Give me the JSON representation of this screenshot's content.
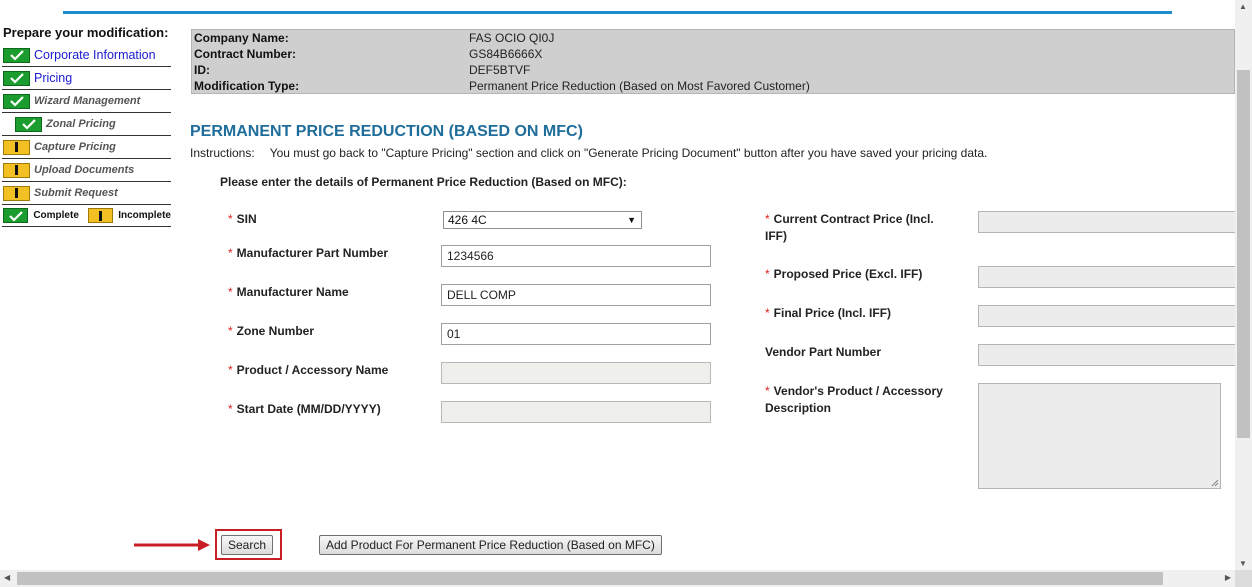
{
  "sidebar": {
    "title": "Prepare your modification:",
    "items": [
      {
        "label": "Corporate Information",
        "status": "complete",
        "style": "link"
      },
      {
        "label": "Pricing",
        "status": "complete",
        "style": "link"
      },
      {
        "label": "Wizard Management",
        "status": "complete",
        "style": "muted"
      },
      {
        "label": "Zonal Pricing",
        "status": "complete",
        "style": "muted"
      },
      {
        "label": "Capture Pricing",
        "status": "incomplete",
        "style": "muted"
      },
      {
        "label": "Upload Documents",
        "status": "incomplete",
        "style": "muted"
      },
      {
        "label": "Submit Request",
        "status": "incomplete",
        "style": "muted"
      }
    ],
    "legend": {
      "complete": "Complete",
      "incomplete": "Incomplete"
    }
  },
  "info": {
    "company_label": "Company Name:",
    "company_value": "FAS OCIO QI0J",
    "contract_label": "Contract Number:",
    "contract_value": "GS84B6666X",
    "id_label": "ID:",
    "id_value": "DEF5BTVF",
    "modtype_label": "Modification Type:",
    "modtype_value": "Permanent Price Reduction (Based on Most Favored Customer)"
  },
  "page": {
    "heading": "PERMANENT PRICE REDUCTION (BASED ON MFC)",
    "instructions_label": "Instructions:",
    "instructions_text": "You must go back to \"Capture Pricing\" section and click on \"Generate Pricing Document\" button after you have saved your pricing data.",
    "subheading": "Please enter the details of Permanent Price Reduction (Based on MFC):"
  },
  "form": {
    "required_marker": "*",
    "sin_label": "SIN",
    "sin_value": "426 4C",
    "mpn_label": "Manufacturer Part Number",
    "mpn_value": "1234566",
    "mname_label": "Manufacturer Name",
    "mname_value": "DELL COMP",
    "zone_label": "Zone Number",
    "zone_value": "01",
    "product_label": "Product / Accessory Name",
    "product_value": "",
    "start_label": "Start Date (MM/DD/YYYY)",
    "start_value": "",
    "ccp_label_1": "Current Contract Price (Incl.",
    "ccp_label_2": "IFF)",
    "proposed_label": "Proposed Price (Excl. IFF)",
    "final_label": "Final Price (Incl. IFF)",
    "vpn_label": "Vendor Part Number",
    "desc_label_1": "Vendor's Product / Accessory",
    "desc_label_2": "Description"
  },
  "buttons": {
    "search": "Search",
    "add_product": "Add Product For Permanent Price Reduction (Based on MFC)"
  },
  "colors": {
    "accent": "#1d8dd0",
    "heading": "#1f6d9a",
    "complete": "#1a9d2e",
    "incomplete": "#f3c023",
    "annotation": "#c81f27"
  }
}
